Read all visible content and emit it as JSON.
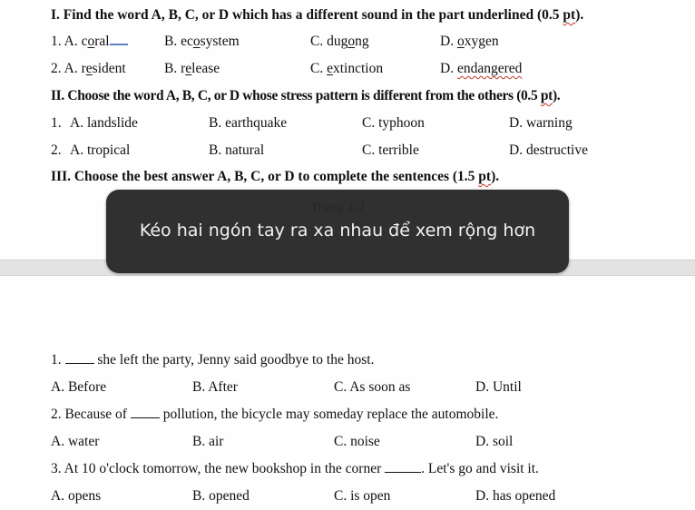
{
  "section1": {
    "heading": "I. Find the word A, B, C, or D which has a different sound in the part underlined (0.5 ",
    "heading_pt": "pt",
    "heading_end": ").",
    "q1": {
      "num": "1. A. ",
      "a_pre": "c",
      "a_u": "o",
      "a_post": "ral",
      "b_pre": "B. ec",
      "b_u": "o",
      "b_post": "system",
      "c_pre": "C. dug",
      "c_u": "o",
      "c_post": "ng",
      "d_pre": "D. ",
      "d_u": "o",
      "d_post": "xygen"
    },
    "q2": {
      "num": "2. A. ",
      "a_pre": "r",
      "a_u": "e",
      "a_post": "sident",
      "b_pre": "B. r",
      "b_u": "e",
      "b_post": "lease",
      "c_pre": "C. ",
      "c_u": "e",
      "c_post": "xtinction",
      "d_pre": "D. ",
      "d_u": "e",
      "d_post": "ndangered"
    }
  },
  "section2": {
    "heading": "II. Choose the word A, B, C, or D whose stress pattern is different from the others (0.5 ",
    "heading_pt": "pt",
    "heading_end": ").",
    "questions": [
      {
        "num": "1.",
        "a": "A. landslide",
        "b": "B. earthquake",
        "c": "C. typhoon",
        "d": "D. warning"
      },
      {
        "num": "2.",
        "a": "A. tropical",
        "b": "B. natural",
        "c": "C. terrible",
        "d": "D. destructive"
      }
    ]
  },
  "section3": {
    "heading": "III. Choose the best answer A, B, C, or D to complete the sentences (1.5 ",
    "heading_pt": "pt",
    "heading_end": ").",
    "questions": [
      {
        "pre": "1. ",
        "post": " she left the party, Jenny said goodbye to the host.",
        "a": "A. Before",
        "b": "B. After",
        "c": "C. As soon as",
        "d": "D. Until"
      },
      {
        "pre": "2. Because of ",
        "post": " pollution, the bicycle may someday replace the automobile.",
        "a": "A. water",
        "b": "B. air",
        "c": "C. noise",
        "d": "D. soil"
      },
      {
        "pre": "3. At 10 o'clock tomorrow, the new bookshop in the corner ",
        "post": ". Let's go and visit it.",
        "a": "A. opens",
        "b": "B. opened",
        "c": "C. is open",
        "d": "D. has opened"
      }
    ]
  },
  "overlay": {
    "page_indicator": "Trang 1/2",
    "message": "Kéo hai ngón tay ra xa nhau để xem rộng hơn"
  }
}
